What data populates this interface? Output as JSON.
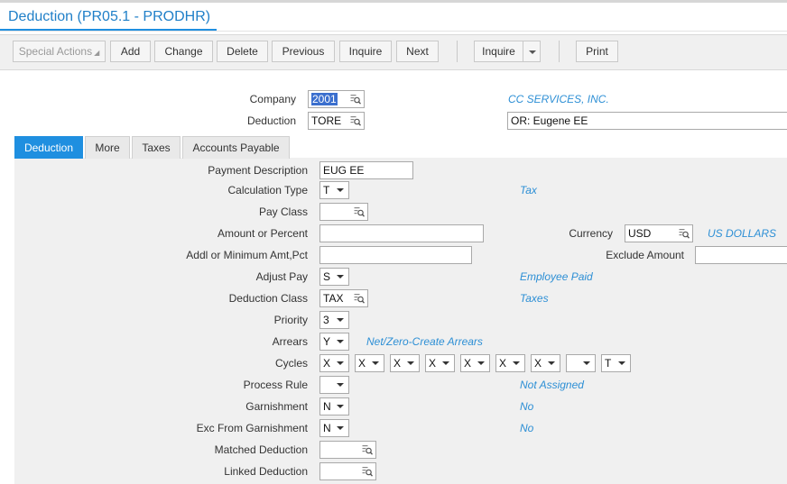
{
  "window": {
    "title": "Deduction (PR05.1 - PRODHR)"
  },
  "toolbar": {
    "special_actions": "Special Actions",
    "add": "Add",
    "change": "Change",
    "delete": "Delete",
    "previous": "Previous",
    "inquire": "Inquire",
    "next": "Next",
    "inquire2": "Inquire",
    "print": "Print"
  },
  "header": {
    "company_label": "Company",
    "company_value": "2001",
    "company_desc": "CC SERVICES, INC.",
    "deduction_label": "Deduction",
    "deduction_value": "TORE",
    "deduction_desc": "OR: Eugene EE"
  },
  "tabs": [
    {
      "label": "Deduction",
      "active": true
    },
    {
      "label": "More"
    },
    {
      "label": "Taxes"
    },
    {
      "label": "Accounts Payable"
    }
  ],
  "form": {
    "payment_description": {
      "label": "Payment Description",
      "value": "EUG EE"
    },
    "calculation_type": {
      "label": "Calculation Type",
      "value": "T",
      "desc": "Tax"
    },
    "pay_class": {
      "label": "Pay Class",
      "value": ""
    },
    "amount_or_percent": {
      "label": "Amount or Percent",
      "value": ""
    },
    "currency": {
      "label": "Currency",
      "value": "USD",
      "desc": "US DOLLARS"
    },
    "addl_min": {
      "label": "Addl or Minimum Amt,Pct",
      "value": ""
    },
    "exclude_amount": {
      "label": "Exclude Amount",
      "value": ""
    },
    "adjust_pay": {
      "label": "Adjust Pay",
      "value": "S",
      "desc": "Employee Paid"
    },
    "deduction_class": {
      "label": "Deduction Class",
      "value": "TAX",
      "desc": "Taxes"
    },
    "priority": {
      "label": "Priority",
      "value": "3"
    },
    "arrears": {
      "label": "Arrears",
      "value": "Y",
      "desc": "Net/Zero-Create Arrears"
    },
    "cycles": {
      "label": "Cycles",
      "values": [
        "X",
        "X",
        "X",
        "X",
        "X",
        "X",
        "X",
        "",
        "T"
      ]
    },
    "process_rule": {
      "label": "Process Rule",
      "value": "",
      "desc": "Not Assigned"
    },
    "garnishment": {
      "label": "Garnishment",
      "value": "N",
      "desc": "No"
    },
    "exc_from_garnishment": {
      "label": "Exc From Garnishment",
      "value": "N",
      "desc": "No"
    },
    "matched_deduction": {
      "label": "Matched Deduction",
      "value": ""
    },
    "linked_deduction": {
      "label": "Linked Deduction",
      "value": ""
    }
  },
  "colors": {
    "accent": "#1f8fe0",
    "desc_text": "#2d8fd5"
  },
  "icons": {
    "lookup": "lookup-icon",
    "dropdown": "chevron-down-icon"
  }
}
